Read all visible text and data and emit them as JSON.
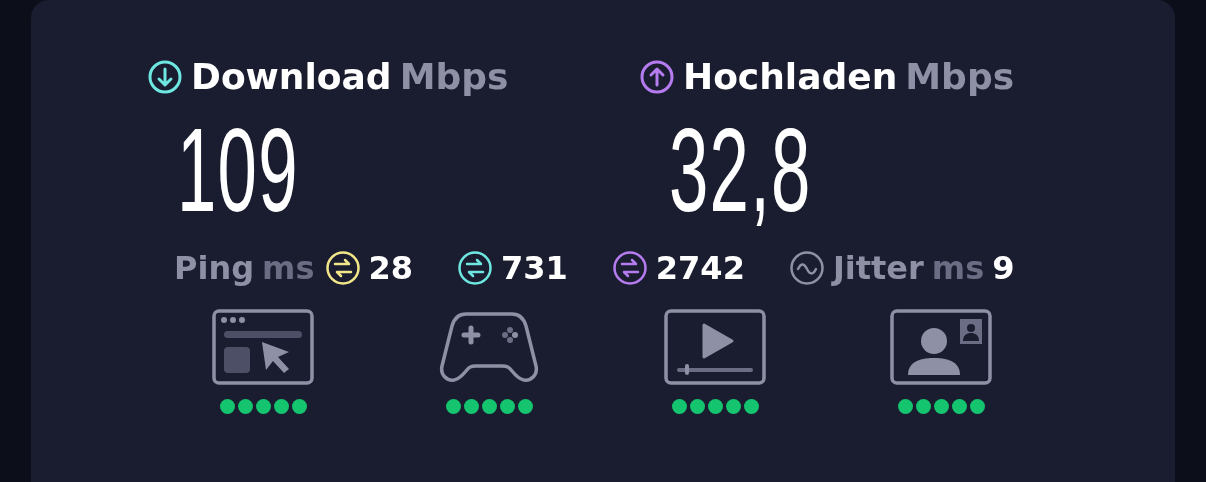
{
  "speeds": [
    {
      "kind": "download",
      "label": "Download",
      "unit": "Mbps",
      "value": "109",
      "color": "#6ee7e0"
    },
    {
      "kind": "upload",
      "label": "Hochladen",
      "unit": "Mbps",
      "value": "32,8",
      "color": "#b57cf0"
    }
  ],
  "latency": {
    "ping_label": "Ping",
    "ping_unit": "ms",
    "items": [
      {
        "kind": "ping",
        "value": "28",
        "color": "#f2e68a"
      },
      {
        "kind": "ping",
        "value": "731",
        "color": "#6ee7e0"
      },
      {
        "kind": "ping",
        "value": "2742",
        "color": "#b57cf0"
      },
      {
        "kind": "jitter",
        "label": "Jitter",
        "unit": "ms",
        "value": "9",
        "color": "#8e90a6"
      }
    ]
  },
  "activities": [
    {
      "kind": "browsing",
      "stars": 5
    },
    {
      "kind": "gaming",
      "stars": 5
    },
    {
      "kind": "video",
      "stars": 5
    },
    {
      "kind": "videocall",
      "stars": 5
    }
  ]
}
